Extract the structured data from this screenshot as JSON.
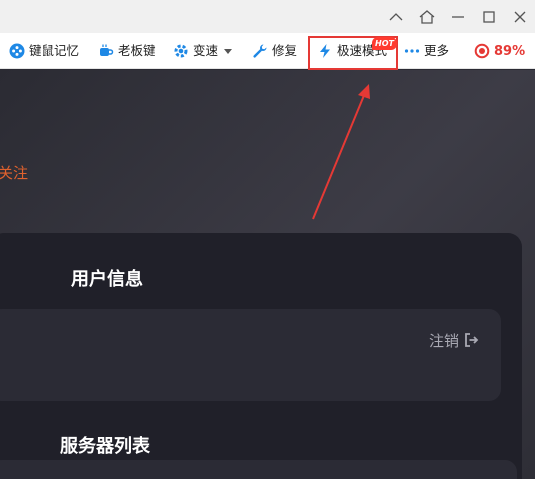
{
  "toolbar": {
    "items": [
      {
        "label": "键鼠记忆",
        "icon": "gamepad-icon"
      },
      {
        "label": "老板键",
        "icon": "coffee-cup-icon"
      },
      {
        "label": "变速",
        "icon": "speed-gear-icon"
      },
      {
        "label": "修复",
        "icon": "wrench-icon"
      },
      {
        "label": "极速模式",
        "icon": "lightning-icon",
        "badge": "HOT"
      },
      {
        "label": "更多",
        "icon": "more-dots-icon"
      }
    ],
    "battery": {
      "value": "89%",
      "percent": 89
    }
  },
  "main": {
    "follow_text": "关注",
    "user_info_title": "用户信息",
    "logout_label": "注销",
    "server_list_title": "服务器列表"
  },
  "colors": {
    "accent_red": "#e53935",
    "accent_orange": "#e0622e",
    "toolbar_blue": "#1e88e5"
  }
}
